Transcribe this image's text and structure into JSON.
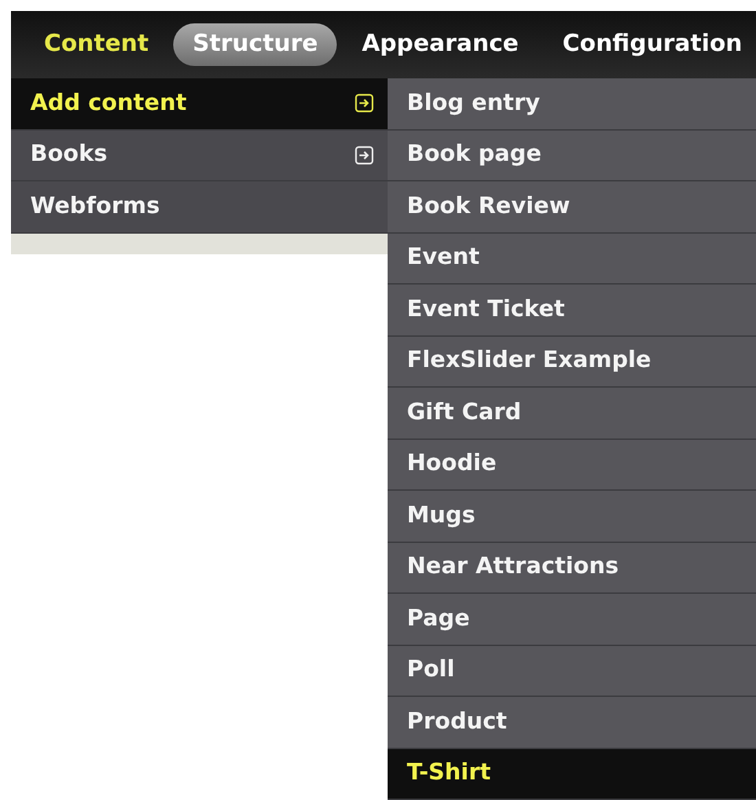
{
  "toolbar": {
    "items": [
      {
        "label": "Content",
        "selected": false,
        "active_trail": true
      },
      {
        "label": "Structure",
        "selected": true,
        "active_trail": false
      },
      {
        "label": "Appearance",
        "selected": false,
        "active_trail": false
      },
      {
        "label": "Configuration",
        "selected": false,
        "active_trail": false
      }
    ]
  },
  "menu": {
    "items": [
      {
        "label": "Add content",
        "selected": true,
        "has_submenu": true
      },
      {
        "label": "Books",
        "selected": false,
        "has_submenu": true
      },
      {
        "label": "Webforms",
        "selected": false,
        "has_submenu": false
      }
    ]
  },
  "submenu": {
    "items": [
      {
        "label": "Blog entry",
        "selected": false
      },
      {
        "label": "Book page",
        "selected": false
      },
      {
        "label": "Book Review",
        "selected": false
      },
      {
        "label": "Event",
        "selected": false
      },
      {
        "label": "Event Ticket",
        "selected": false
      },
      {
        "label": "FlexSlider Example",
        "selected": false
      },
      {
        "label": "Gift Card",
        "selected": false
      },
      {
        "label": "Hoodie",
        "selected": false
      },
      {
        "label": "Mugs",
        "selected": false
      },
      {
        "label": "Near Attractions",
        "selected": false
      },
      {
        "label": "Page",
        "selected": false
      },
      {
        "label": "Poll",
        "selected": false
      },
      {
        "label": "Product",
        "selected": false
      },
      {
        "label": "T-Shirt",
        "selected": true
      }
    ]
  }
}
